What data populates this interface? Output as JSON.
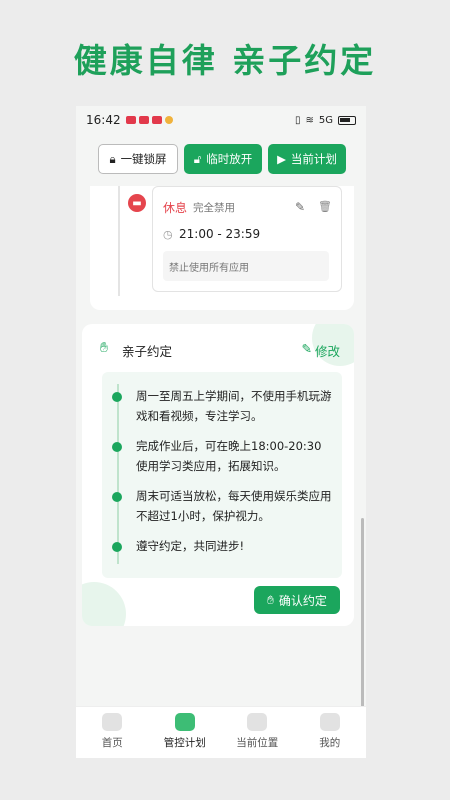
{
  "promo": {
    "headline": "健康自律 亲子约定"
  },
  "status_bar": {
    "time": "16:42",
    "network": "5G"
  },
  "toolbar": {
    "lock_label": "一键锁屏",
    "open_label": "临时放开",
    "plan_label": "当前计划"
  },
  "schedule_slot": {
    "title": "休息",
    "tag": "完全禁用",
    "time_range": "21:00 - 23:59",
    "note": "禁止使用所有应用"
  },
  "agreement": {
    "title": "亲子约定",
    "edit_label": "修改",
    "rules": [
      "周一至周五上学期间，不使用手机玩游戏和看视频，专注学习。",
      "完成作业后，可在晚上18:00-20:30使用学习类应用，拓展知识。",
      "周末可适当放松，每天使用娱乐类应用不超过1小时，保护视力。",
      "遵守约定，共同进步!"
    ],
    "confirm_label": "确认约定"
  },
  "tabs": [
    {
      "label": "首页",
      "icon": "home-icon",
      "active": false
    },
    {
      "label": "管控计划",
      "icon": "plan-icon",
      "active": true
    },
    {
      "label": "当前位置",
      "icon": "location-icon",
      "active": false
    },
    {
      "label": "我的",
      "icon": "profile-icon",
      "active": false
    }
  ],
  "colors": {
    "accent": "#1ba65d",
    "danger": "#e5454d",
    "headline": "#1ea05a"
  }
}
